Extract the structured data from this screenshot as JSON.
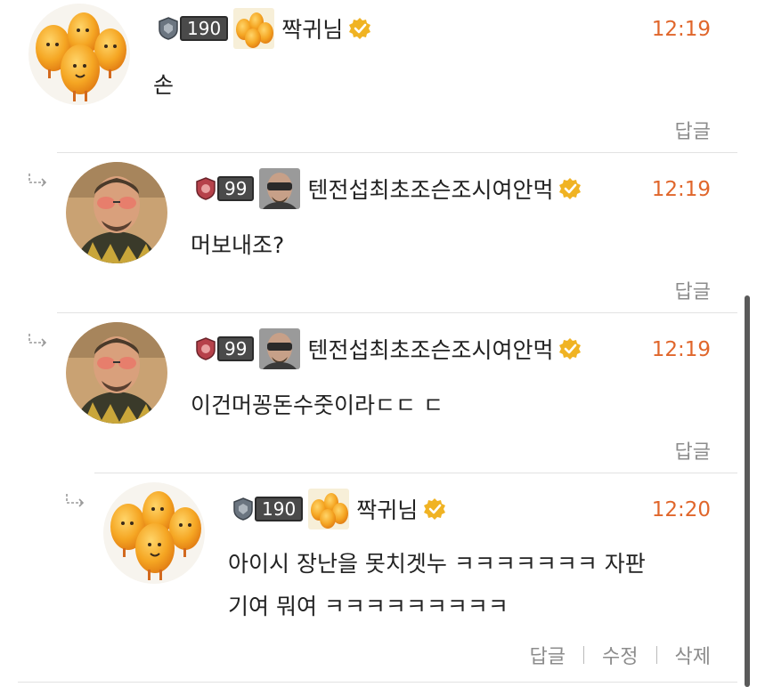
{
  "comments": [
    {
      "level": "190",
      "username": "짝귀님",
      "time": "12:19",
      "text": "손",
      "actions": [
        "답글"
      ],
      "avatar": "orange-characters"
    },
    {
      "level": "99",
      "username": "텐전섭최초조슨조시여안먹",
      "time": "12:19",
      "text": "머보내조?",
      "actions": [
        "답글"
      ],
      "avatar": "man-sunglasses"
    },
    {
      "level": "99",
      "username": "텐전섭최초조슨조시여안먹",
      "time": "12:19",
      "text": "이건머꽁돈수줏이라ㄷㄷ ㄷ",
      "actions": [
        "답글"
      ],
      "avatar": "man-sunglasses"
    },
    {
      "level": "190",
      "username": "짝귀님",
      "time": "12:20",
      "text_line1": "아이시 장난을 못치겟누 ㅋㅋㅋㅋㅋㅋㅋ 자판",
      "text_line2": "기여 뭐여 ㅋㅋㅋㅋㅋㅋㅋㅋㅋ",
      "actions": [
        "답글",
        "수정",
        "삭제"
      ],
      "avatar": "orange-characters"
    }
  ],
  "colors": {
    "time": "#e0662b",
    "verified": "#f0b323",
    "action_text": "#8c8c8c"
  }
}
